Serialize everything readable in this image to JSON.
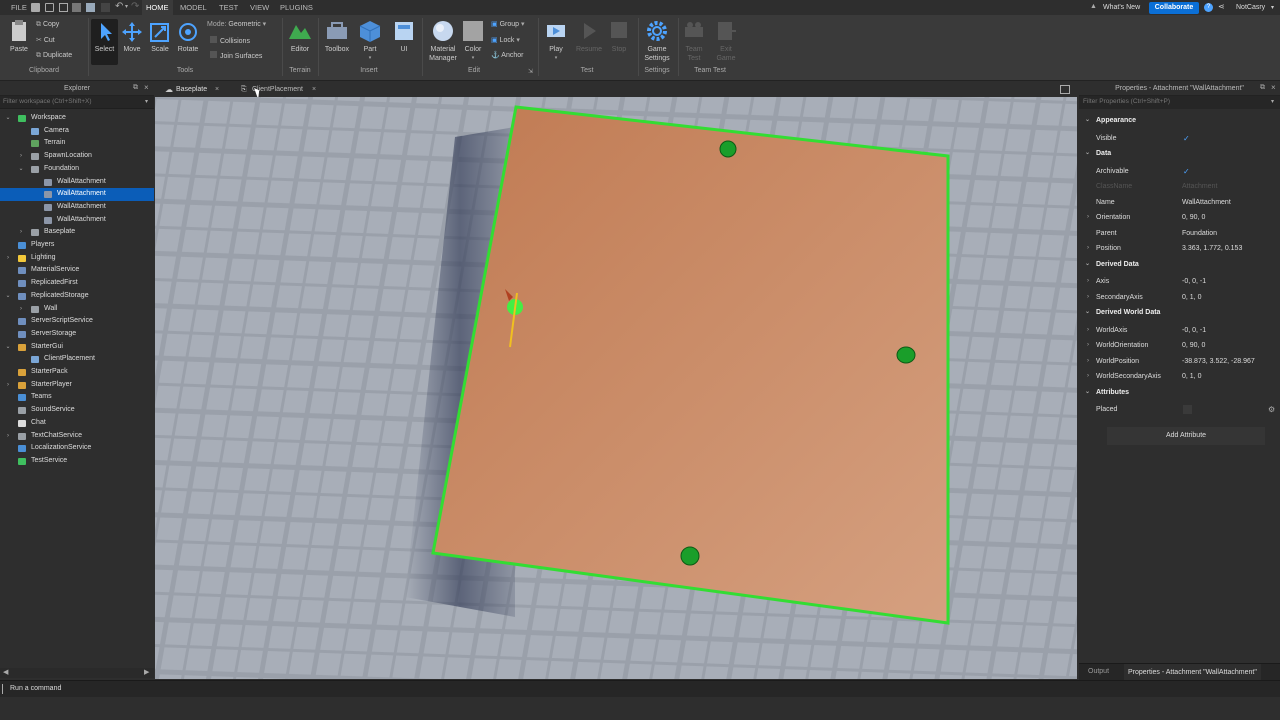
{
  "menu_tabs": [
    "FILE",
    "HOME",
    "MODEL",
    "TEST",
    "VIEW",
    "PLUGINS"
  ],
  "active_tab": "HOME",
  "top_right": {
    "whats_new": "What's New",
    "collaborate": "Collaborate",
    "user": "NotCasry"
  },
  "ribbon": {
    "clipboard": {
      "paste": "Paste",
      "copy": "Copy",
      "cut": "Cut",
      "duplicate": "Duplicate",
      "label": "Clipboard"
    },
    "tools": {
      "select": "Select",
      "move": "Move",
      "scale": "Scale",
      "rotate": "Rotate",
      "mode_label": "Mode:",
      "mode_value": "Geometric",
      "collisions": "Collisions",
      "join_surfaces": "Join Surfaces",
      "label": "Tools"
    },
    "terrain": {
      "editor": "Editor",
      "label": "Terrain"
    },
    "insert": {
      "toolbox": "Toolbox",
      "part": "Part",
      "ui": "UI",
      "label": "Insert"
    },
    "edit": {
      "material_manager_1": "Material",
      "material_manager_2": "Manager",
      "color": "Color",
      "group": "Group",
      "lock": "Lock",
      "anchor": "Anchor",
      "label": "Edit"
    },
    "test": {
      "play": "Play",
      "resume": "Resume",
      "stop": "Stop",
      "label": "Test"
    },
    "settings": {
      "game_settings_1": "Game",
      "game_settings_2": "Settings",
      "label": "Settings"
    },
    "team_test": {
      "team_test_1": "Team",
      "team_test_2": "Test",
      "exit_game_1": "Exit",
      "exit_game_2": "Game",
      "label": "Team Test"
    }
  },
  "explorer": {
    "title": "Explorer",
    "filter_placeholder": "Filter workspace (Ctrl+Shift+X)",
    "items": [
      {
        "label": "Workspace",
        "indent": 0,
        "arrow": "v",
        "color": "#3fbf5f"
      },
      {
        "label": "Camera",
        "indent": 1,
        "arrow": "",
        "color": "#7aa6d6"
      },
      {
        "label": "Terrain",
        "indent": 1,
        "arrow": "",
        "color": "#5fa35f"
      },
      {
        "label": "SpawnLocation",
        "indent": 1,
        "arrow": ">",
        "color": "#9aa0a6"
      },
      {
        "label": "Foundation",
        "indent": 1,
        "arrow": "v",
        "color": "#9aa0a6"
      },
      {
        "label": "WallAttachment",
        "indent": 2,
        "arrow": "",
        "color": "#8c96a8"
      },
      {
        "label": "WallAttachment",
        "indent": 2,
        "arrow": "",
        "color": "#8c96a8",
        "selected": true
      },
      {
        "label": "WallAttachment",
        "indent": 2,
        "arrow": "",
        "color": "#8c96a8"
      },
      {
        "label": "WallAttachment",
        "indent": 2,
        "arrow": "",
        "color": "#8c96a8"
      },
      {
        "label": "Baseplate",
        "indent": 1,
        "arrow": ">",
        "color": "#9aa0a6"
      },
      {
        "label": "Players",
        "indent": 0,
        "arrow": "",
        "color": "#4a8fd6"
      },
      {
        "label": "Lighting",
        "indent": 0,
        "arrow": ">",
        "color": "#f2c83a"
      },
      {
        "label": "MaterialService",
        "indent": 0,
        "arrow": "",
        "color": "#6f8fbf"
      },
      {
        "label": "ReplicatedFirst",
        "indent": 0,
        "arrow": "",
        "color": "#6f8fbf"
      },
      {
        "label": "ReplicatedStorage",
        "indent": 0,
        "arrow": "v",
        "color": "#6f8fbf"
      },
      {
        "label": "Wall",
        "indent": 1,
        "arrow": ">",
        "color": "#9aa0a6"
      },
      {
        "label": "ServerScriptService",
        "indent": 0,
        "arrow": "",
        "color": "#6f8fbf"
      },
      {
        "label": "ServerStorage",
        "indent": 0,
        "arrow": "",
        "color": "#6f8fbf"
      },
      {
        "label": "StarterGui",
        "indent": 0,
        "arrow": "v",
        "color": "#d9a13a"
      },
      {
        "label": "ClientPlacement",
        "indent": 1,
        "arrow": "",
        "color": "#7aa6d6"
      },
      {
        "label": "StarterPack",
        "indent": 0,
        "arrow": "",
        "color": "#d9a13a"
      },
      {
        "label": "StarterPlayer",
        "indent": 0,
        "arrow": ">",
        "color": "#d9a13a"
      },
      {
        "label": "Teams",
        "indent": 0,
        "arrow": "",
        "color": "#4a8fd6"
      },
      {
        "label": "SoundService",
        "indent": 0,
        "arrow": "",
        "color": "#9aa0a6"
      },
      {
        "label": "Chat",
        "indent": 0,
        "arrow": "",
        "color": "#dddddd"
      },
      {
        "label": "TextChatService",
        "indent": 0,
        "arrow": ">",
        "color": "#9aa0a6"
      },
      {
        "label": "LocalizationService",
        "indent": 0,
        "arrow": "",
        "color": "#4a8fd6"
      },
      {
        "label": "TestService",
        "indent": 0,
        "arrow": "",
        "color": "#3fbf5f"
      }
    ]
  },
  "doc_tabs": [
    {
      "label": "Baseplate",
      "close": "×"
    },
    {
      "label": "ClientPlacement",
      "close": "×"
    }
  ],
  "properties": {
    "title": "Properties - Attachment \"WallAttachment\"",
    "filter_placeholder": "Filter Properties (Ctrl+Shift+P)",
    "rows": [
      {
        "kind": "cat",
        "name": "Appearance"
      },
      {
        "kind": "check",
        "name": "Visible",
        "value": "✓"
      },
      {
        "kind": "cat",
        "name": "Data"
      },
      {
        "kind": "check",
        "name": "Archivable",
        "value": "✓"
      },
      {
        "kind": "dim",
        "name": "ClassName",
        "value": "Attachment"
      },
      {
        "kind": "prop",
        "name": "Name",
        "value": "WallAttachment"
      },
      {
        "kind": "expand",
        "name": "Orientation",
        "value": "0, 90, 0"
      },
      {
        "kind": "prop",
        "name": "Parent",
        "value": "Foundation"
      },
      {
        "kind": "expand",
        "name": "Position",
        "value": "3.363, 1.772, 0.153"
      },
      {
        "kind": "cat",
        "name": "Derived Data"
      },
      {
        "kind": "expand",
        "name": "Axis",
        "value": "-0, 0, -1"
      },
      {
        "kind": "expand",
        "name": "SecondaryAxis",
        "value": "0, 1, 0"
      },
      {
        "kind": "cat",
        "name": "Derived World Data"
      },
      {
        "kind": "expand",
        "name": "WorldAxis",
        "value": "-0, 0, -1"
      },
      {
        "kind": "expand",
        "name": "WorldOrientation",
        "value": "0, 90, 0"
      },
      {
        "kind": "expand",
        "name": "WorldPosition",
        "value": "-38.873, 3.522, -28.967"
      },
      {
        "kind": "expand",
        "name": "WorldSecondaryAxis",
        "value": "0, 1, 0"
      },
      {
        "kind": "cat",
        "name": "Attributes"
      },
      {
        "kind": "box",
        "name": "Placed",
        "value": ""
      }
    ],
    "add_attribute": "Add Attribute",
    "bottom_tabs": [
      "Output",
      "Properties - Attachment \"WallAttachment\""
    ]
  },
  "command_bar": {
    "placeholder": "Run a command"
  },
  "colors": {
    "accent": "#0b5db8",
    "selection": "#33dd33",
    "part": "#c98a63",
    "attachment": "#1a9e2a"
  }
}
